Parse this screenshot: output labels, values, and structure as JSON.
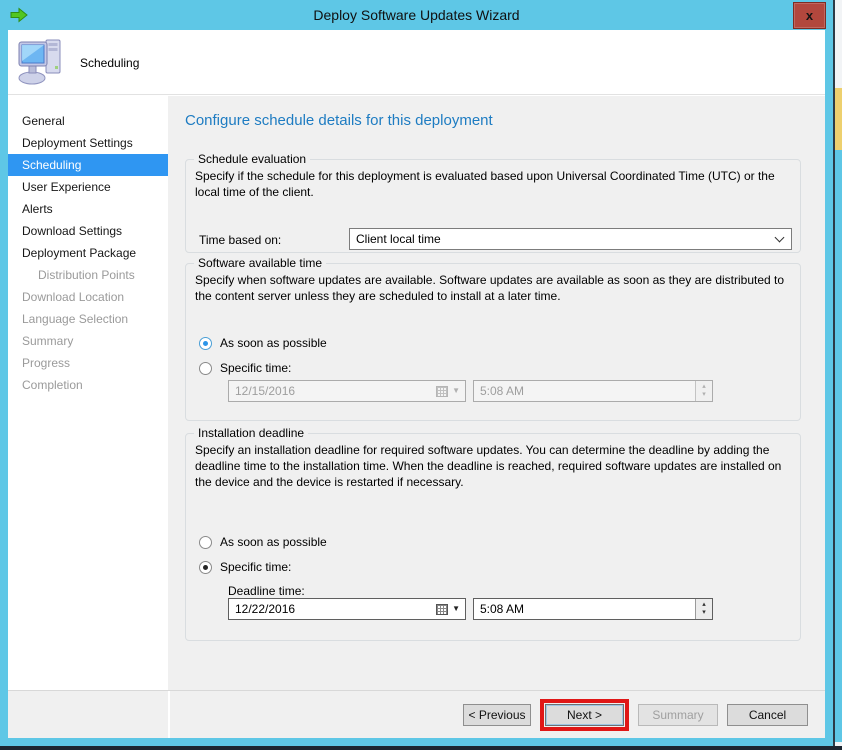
{
  "window": {
    "title": "Deploy Software Updates Wizard",
    "close_glyph": "x"
  },
  "header": {
    "page_title": "Scheduling"
  },
  "sidebar": {
    "items": [
      {
        "label": "General",
        "state": "enabled"
      },
      {
        "label": "Deployment Settings",
        "state": "enabled"
      },
      {
        "label": "Scheduling",
        "state": "active"
      },
      {
        "label": "User Experience",
        "state": "enabled"
      },
      {
        "label": "Alerts",
        "state": "enabled"
      },
      {
        "label": "Download Settings",
        "state": "enabled"
      },
      {
        "label": "Deployment Package",
        "state": "enabled"
      },
      {
        "label": "Distribution Points",
        "state": "disabled-indent"
      },
      {
        "label": "Download Location",
        "state": "disabled"
      },
      {
        "label": "Language Selection",
        "state": "disabled"
      },
      {
        "label": "Summary",
        "state": "disabled"
      },
      {
        "label": "Progress",
        "state": "disabled"
      },
      {
        "label": "Completion",
        "state": "disabled"
      }
    ]
  },
  "main": {
    "heading": "Configure schedule details for this deployment",
    "schedule_evaluation": {
      "label": "Schedule evaluation",
      "description": "Specify if the schedule for this deployment is evaluated based upon Universal Coordinated Time (UTC) or the local time of the client.",
      "time_based_on_label": "Time based on:",
      "time_based_on_value": "Client local time"
    },
    "software_available_time": {
      "label": "Software available time",
      "description": "Specify when software updates are available. Software updates are available as soon as they are distributed to the content server unless they are scheduled to install at a later time.",
      "asap_label": "As soon as possible",
      "specific_label": "Specific time:",
      "date_value": "12/15/2016",
      "time_value": "5:08 AM"
    },
    "installation_deadline": {
      "label": "Installation deadline",
      "description": "Specify an installation deadline for required software updates. You can determine the deadline by adding the deadline time to the installation time. When the deadline is reached, required software updates are installed on the device and the device is restarted if necessary.",
      "asap_label": "As soon as possible",
      "specific_label": "Specific time:",
      "deadline_time_label": "Deadline time:",
      "date_value": "12/22/2016",
      "time_value": "5:08 AM"
    }
  },
  "footer": {
    "previous_label": "< Previous",
    "next_label": "Next >",
    "summary_label": "Summary",
    "cancel_label": "Cancel"
  },
  "colors": {
    "frame-blue": "#5ec7e6",
    "frame-dark": "#2c3b47",
    "taskbar-dark": "#1c2631",
    "sidebar-active": "#2f96f2",
    "heading-blue": "#1e7cc2",
    "annotation-red": "#e01717",
    "close-red": "#b2473d",
    "bg-yellow": "#edd06e"
  }
}
